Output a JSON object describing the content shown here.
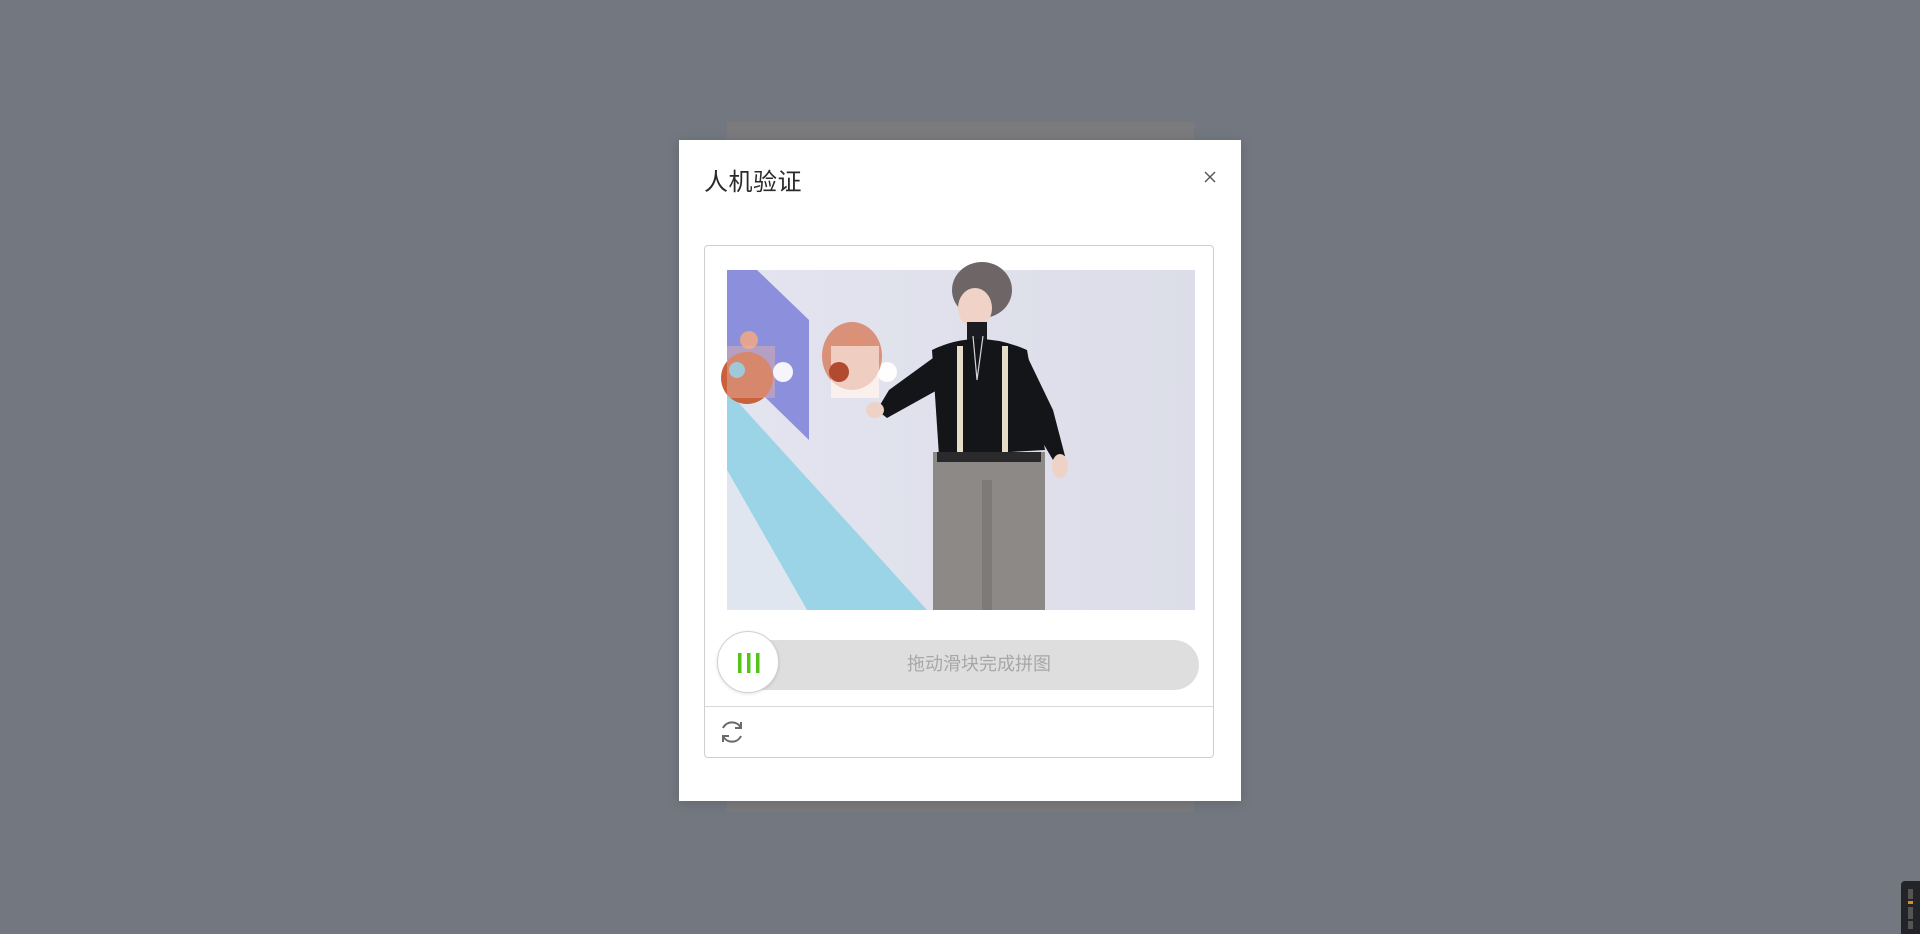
{
  "dialog": {
    "title": "人机验证",
    "close_icon": "close-icon"
  },
  "captcha": {
    "image_description_icon": "puzzle-image",
    "slider_hint": "拖动滑块完成拼图",
    "handle_icon": "grip-lines-icon",
    "refresh_icon": "refresh-icon",
    "slider_progress": 0
  },
  "colors": {
    "overlay": "#737780",
    "grip_accent": "#52c41a",
    "track": "#dedede",
    "hint_text": "#a7a7a7"
  }
}
